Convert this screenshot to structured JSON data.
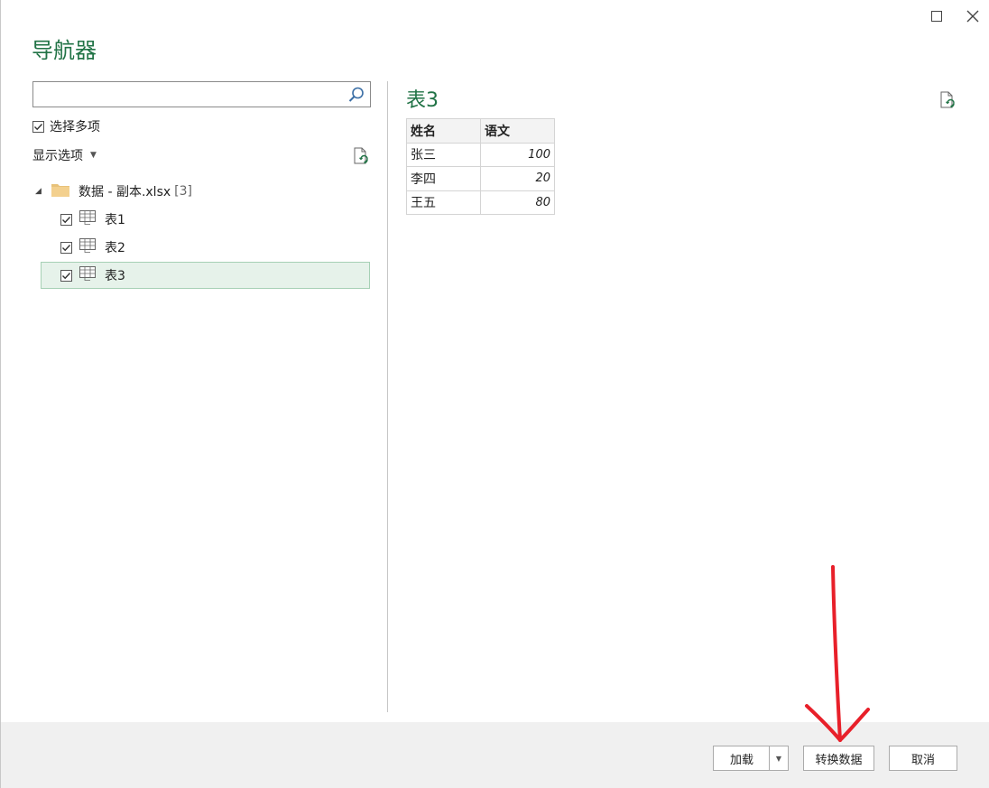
{
  "window": {
    "title": "导航器"
  },
  "search": {
    "value": "",
    "placeholder": ""
  },
  "multi_select": {
    "label": "选择多项",
    "checked": true
  },
  "display_options": {
    "label": "显示选项"
  },
  "tree": {
    "root": {
      "name": "数据 - 副本.xlsx",
      "count": "[3]"
    },
    "items": [
      {
        "label": "表1",
        "checked": true,
        "selected": false
      },
      {
        "label": "表2",
        "checked": true,
        "selected": false
      },
      {
        "label": "表3",
        "checked": true,
        "selected": true
      }
    ]
  },
  "preview": {
    "title": "表3",
    "columns": [
      "姓名",
      "语文"
    ],
    "rows": [
      [
        "张三",
        "100"
      ],
      [
        "李四",
        "20"
      ],
      [
        "王五",
        "80"
      ]
    ]
  },
  "footer": {
    "load_label": "加载",
    "transform_label": "转换数据",
    "cancel_label": "取消"
  },
  "colors": {
    "accent": "#217346",
    "selected_bg": "#e6f2ea",
    "annotation": "#e8202a"
  },
  "icons": [
    "maximize-icon",
    "close-icon",
    "search-icon",
    "refresh-icon",
    "folder-icon",
    "table-icon",
    "expand-triangle-icon",
    "dropdown-caret-icon",
    "red-arrow-annotation"
  ]
}
